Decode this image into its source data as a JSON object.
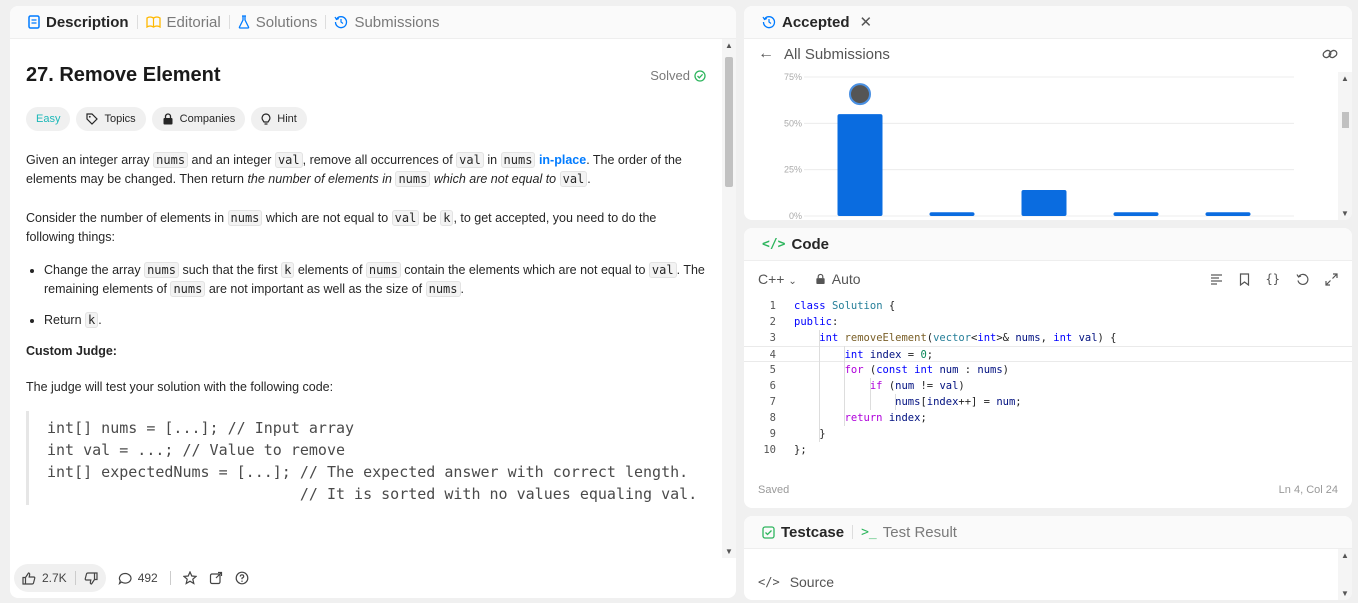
{
  "left_tabs": [
    {
      "label": "Description",
      "icon": "description-icon",
      "color": "#007bff"
    },
    {
      "label": "Editorial",
      "icon": "book-icon",
      "color": "#ffb800"
    },
    {
      "label": "Solutions",
      "icon": "flask-icon",
      "color": "#007bff"
    },
    {
      "label": "Submissions",
      "icon": "history-icon",
      "color": "#007bff"
    }
  ],
  "problem": {
    "title": "27. Remove Element",
    "solved_label": "Solved",
    "difficulty": "Easy",
    "topics": "Topics",
    "companies": "Companies",
    "hint": "Hint"
  },
  "description": {
    "p1": {
      "t1": "Given an integer array ",
      "c1": "nums",
      "t2": " and an integer ",
      "c2": "val",
      "t3": ", remove all occurrences of ",
      "c3": "val",
      "t4": " in ",
      "c4": "nums",
      "t5": " ",
      "link": "in-place",
      "t6": ". The order of the elements may be changed. Then return ",
      "em1": "the number of elements in ",
      "c5": "nums",
      "em2": " which are not equal to ",
      "c6": "val",
      "t7": "."
    },
    "p2": {
      "t1": "Consider the number of elements in ",
      "c1": "nums",
      "t2": " which are not equal to ",
      "c2": "val",
      "t3": " be ",
      "c3": "k",
      "t4": ", to get accepted, you need to do the following things:"
    },
    "b1": {
      "t1": "Change the array ",
      "c1": "nums",
      "t2": " such that the first ",
      "c2": "k",
      "t3": " elements of ",
      "c3": "nums",
      "t4": " contain the elements which are not equal to ",
      "c4": "val",
      "t5": ". The remaining elements of ",
      "c5": "nums",
      "t6": " are not important as well as the size of ",
      "c6": "nums",
      "t7": "."
    },
    "b2": {
      "t1": "Return ",
      "c1": "k",
      "t2": "."
    },
    "custom_judge": "Custom Judge:",
    "p3": "The judge will test your solution with the following code:",
    "codeblock": "int[] nums = [...]; // Input array\nint val = ...; // Value to remove\nint[] expectedNums = [...]; // The expected answer with correct length.\n                            // It is sorted with no values equaling val."
  },
  "bottom_bar": {
    "likes": "2.7K",
    "comments": "492"
  },
  "accepted_panel": {
    "tab_label": "Accepted",
    "back_label": "All Submissions"
  },
  "chart_data": {
    "type": "bar",
    "ylabel": "",
    "yticks": [
      "75%",
      "50%",
      "25%",
      "0%"
    ],
    "ylim": [
      0,
      75
    ],
    "values": [
      55,
      2,
      14,
      2,
      2
    ],
    "grid": true,
    "bar_color": "#0a6ce0",
    "marker_on_bar": 0
  },
  "code_panel": {
    "title": "Code",
    "language": "C++",
    "mode": "Auto",
    "status_left": "Saved",
    "status_right": "Ln 4, Col 24",
    "line_numbers": [
      "1",
      "2",
      "3",
      "4",
      "5",
      "6",
      "7",
      "8",
      "9",
      "10"
    ]
  },
  "testcase_panel": {
    "tab1": "Testcase",
    "tab2": "Test Result",
    "source": "Source",
    "accent": "#2db55d"
  }
}
